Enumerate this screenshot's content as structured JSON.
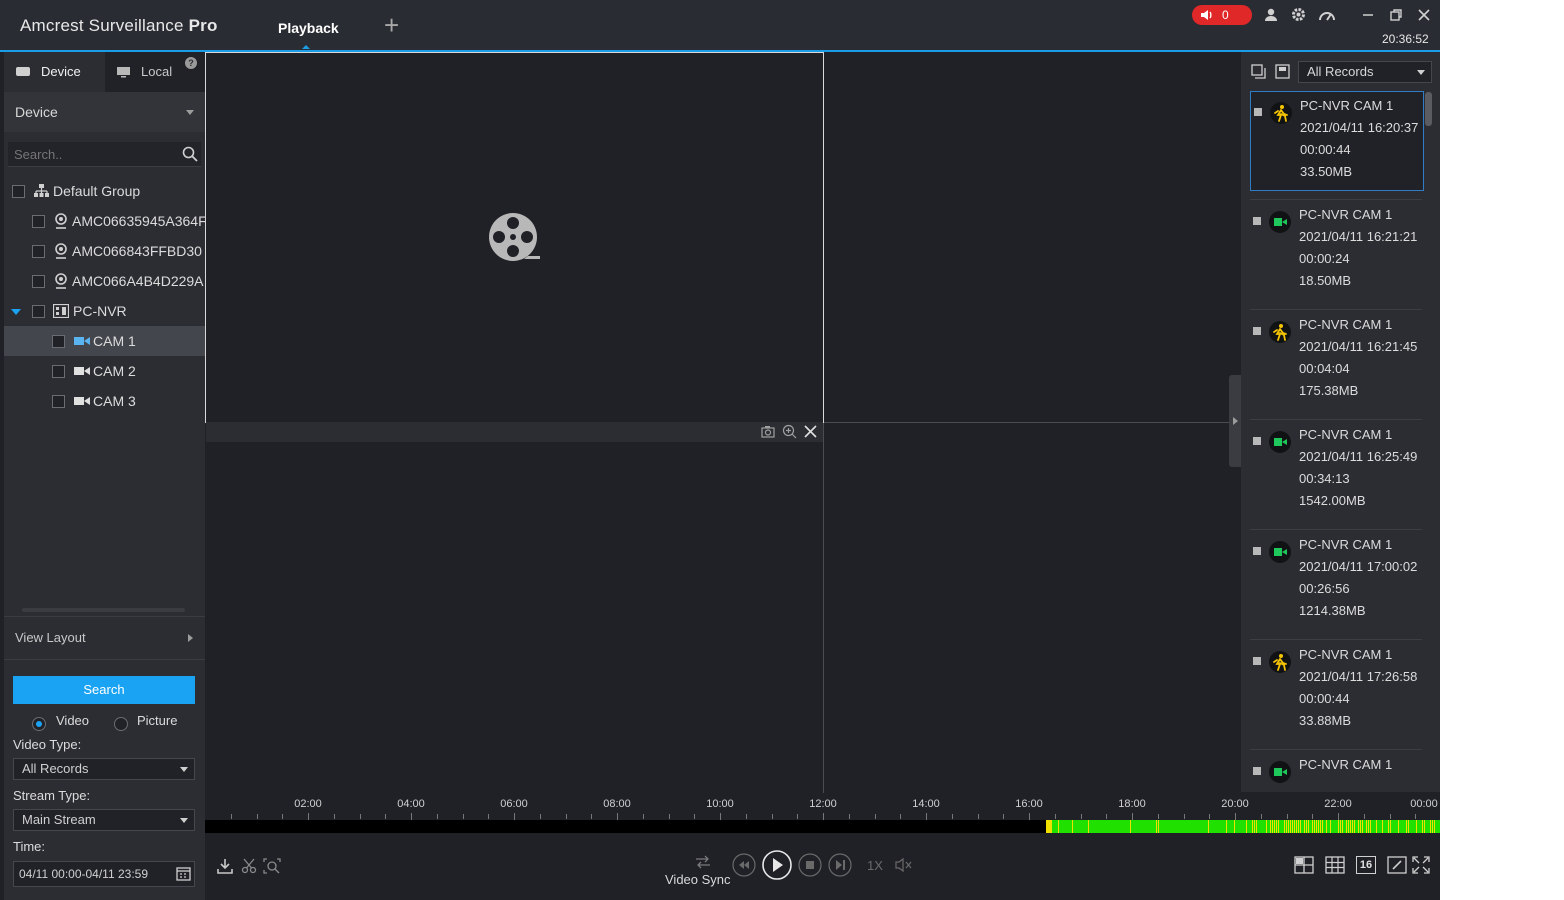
{
  "app": {
    "brand_main": "Amcrest Surveillance",
    "brand_suffix": "Pro",
    "active_tab": "Playback",
    "add_tab": "+",
    "alarm_count": "0",
    "clock": "20:36:52"
  },
  "left_panel": {
    "tabs": [
      "Device",
      "Local"
    ],
    "help": "?",
    "device_dropdown": "Device",
    "search_placeholder": "Search..",
    "tree": [
      {
        "label": "Default Group",
        "level": 0,
        "icon": "group-icon"
      },
      {
        "label": "AMC06635945A364F",
        "level": 1,
        "icon": "ip-camera-icon"
      },
      {
        "label": "AMC066843FFBD30",
        "level": 1,
        "icon": "ip-camera-icon"
      },
      {
        "label": "AMC066A4B4D229A",
        "level": 1,
        "icon": "ip-camera-icon"
      },
      {
        "label": "PC-NVR",
        "level": 1,
        "icon": "nvr-icon"
      },
      {
        "label": "CAM 1",
        "level": 2,
        "icon": "channel-camera-icon",
        "selected": true
      },
      {
        "label": "CAM 2",
        "level": 2,
        "icon": "channel-camera-icon"
      },
      {
        "label": "CAM 3",
        "level": 2,
        "icon": "channel-camera-icon"
      }
    ],
    "view_layout": "View Layout",
    "search_button": "Search",
    "radio_video": "Video",
    "radio_picture": "Picture",
    "video_type_label": "Video Type:",
    "video_type_value": "All Records",
    "stream_type_label": "Stream Type:",
    "stream_type_value": "Main Stream",
    "time_label": "Time:",
    "time_value": "04/11 00:00-04/11 23:59"
  },
  "right_panel": {
    "filter": "All Records",
    "records": [
      {
        "name": "PC-NVR CAM 1",
        "start": "2021/04/11 16:20:37",
        "duration": "00:00:44",
        "size": "33.50MB",
        "type": "motion",
        "selected": true
      },
      {
        "name": "PC-NVR CAM 1",
        "start": "2021/04/11 16:21:21",
        "duration": "00:00:24",
        "size": "18.50MB",
        "type": "video"
      },
      {
        "name": "PC-NVR CAM 1",
        "start": "2021/04/11 16:21:45",
        "duration": "00:04:04",
        "size": "175.38MB",
        "type": "motion"
      },
      {
        "name": "PC-NVR CAM 1",
        "start": "2021/04/11 16:25:49",
        "duration": "00:34:13",
        "size": "1542.00MB",
        "type": "video"
      },
      {
        "name": "PC-NVR CAM 1",
        "start": "2021/04/11 17:00:02",
        "duration": "00:26:56",
        "size": "1214.38MB",
        "type": "video"
      },
      {
        "name": "PC-NVR CAM 1",
        "start": "2021/04/11 17:26:58",
        "duration": "00:00:44",
        "size": "33.88MB",
        "type": "motion"
      },
      {
        "name": "PC-NVR CAM 1",
        "start": "",
        "duration": "",
        "size": "",
        "type": "video"
      }
    ],
    "colors": {
      "motion": "#f5c400",
      "video": "#1ec85a"
    }
  },
  "timeline": {
    "labels": [
      "02:00",
      "04:00",
      "06:00",
      "08:00",
      "10:00",
      "12:00",
      "14:00",
      "16:00",
      "18:00",
      "20:00",
      "22:00",
      "00:00"
    ],
    "record_start_hour": 16.33,
    "record_end_hour": 24,
    "colors": {
      "video": "#20e000",
      "motion": "#f0e000"
    }
  },
  "controls": {
    "video_sync": "Video Sync",
    "speed": "1X",
    "layout_16": "16"
  }
}
